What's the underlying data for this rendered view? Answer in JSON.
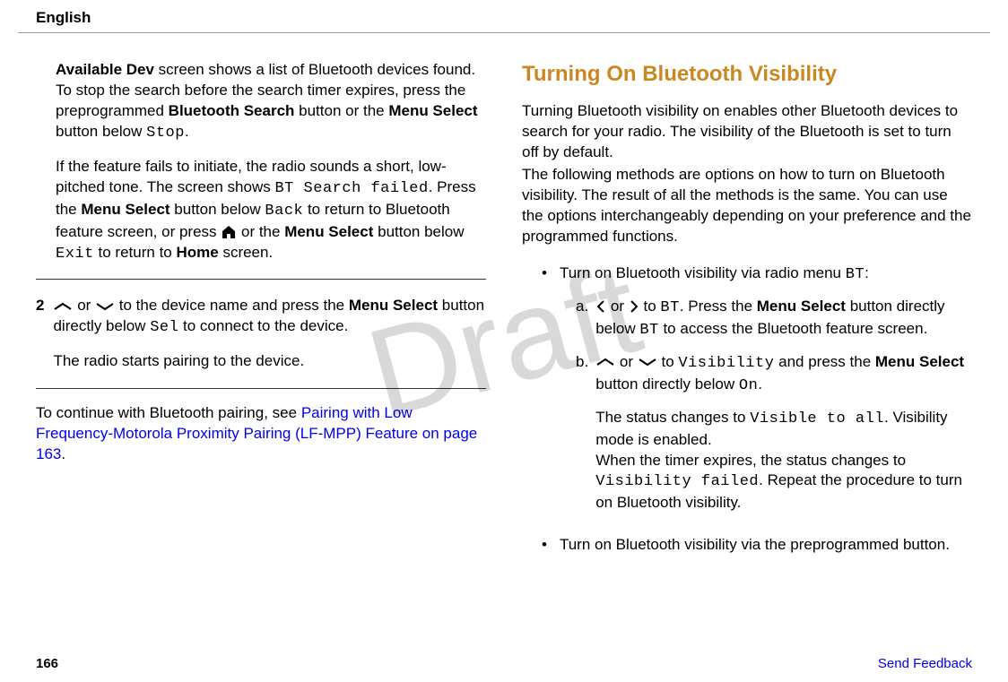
{
  "header": {
    "language": "English"
  },
  "watermark": "Draft",
  "col1": {
    "p1_a": "Available Dev",
    "p1_b": " screen shows a list of Bluetooth devices found. To stop the search before the search timer expires, press the preprogrammed ",
    "p1_c": "Bluetooth Search",
    "p1_d": " button or the ",
    "p1_e": "Menu Select",
    "p1_f": " button below ",
    "p1_g": "Stop",
    "p1_h": ".",
    "p2_a": "If the feature fails to initiate, the radio sounds a short, low-pitched tone. The screen shows ",
    "p2_b": "BT Search failed",
    "p2_c": ". Press the ",
    "p2_d": "Menu Select",
    "p2_e": " button below ",
    "p2_f": "Back",
    "p2_g": " to return to Bluetooth feature screen, or press ",
    "p2_h": " or the ",
    "p2_i": "Menu Select",
    "p2_j": " button below ",
    "p2_k": "Exit",
    "p2_l": " to return to ",
    "p2_m": "Home",
    "p2_n": " screen.",
    "step_num": "2",
    "s1_a": " or ",
    "s1_b": " to the device name and press the ",
    "s1_c": "Menu Select",
    "s1_d": " button directly below ",
    "s1_e": "Sel",
    "s1_f": " to connect to the device.",
    "s1_sub": "The radio starts pairing to the device.",
    "p3_a": "To continue with Bluetooth pairing, see ",
    "p3_b": "Pairing with Low Frequency-Motorola Proximity Pairing (LF-MPP) Feature on page 163",
    "p3_c": "."
  },
  "col2": {
    "heading": "Turning On Bluetooth Visibility",
    "p1": "Turning Bluetooth visibility on enables other Bluetooth devices to search for your radio. The visibility of the Bluetooth is set to turn off by default.",
    "p2": "The following methods are options on how to turn on Bluetooth visibility. The result of all the methods is the same. You can use the options interchangeably depending on your preference and the programmed functions.",
    "b1_a": "Turn on Bluetooth visibility via radio menu ",
    "b1_b": "BT",
    "b1_c": ":",
    "a_label": "a.",
    "a1": " or ",
    "a2": " to ",
    "a3": "BT",
    "a4": ". Press the ",
    "a5": "Menu Select",
    "a6": " button directly below ",
    "a7": "BT",
    "a8": " to access the Bluetooth feature screen.",
    "b_label": "b.",
    "b_1": " or ",
    "b_2": " to ",
    "b_3": "Visibility",
    "b_4": " and press the ",
    "b_5": "Menu Select",
    "b_6": " button directly below ",
    "b_7": "On",
    "b_8": ".",
    "bsub_1": "The status changes to ",
    "bsub_2": "Visible to all",
    "bsub_3": ". Visibility mode is enabled.",
    "bsub_4": "When the timer expires, the status changes to ",
    "bsub_5": "Visibility failed",
    "bsub_6": ". Repeat the procedure to turn on Bluetooth visibility.",
    "b2": "Turn on Bluetooth visibility via the preprogrammed button."
  },
  "footer": {
    "page": "166",
    "feedback": "Send Feedback"
  }
}
